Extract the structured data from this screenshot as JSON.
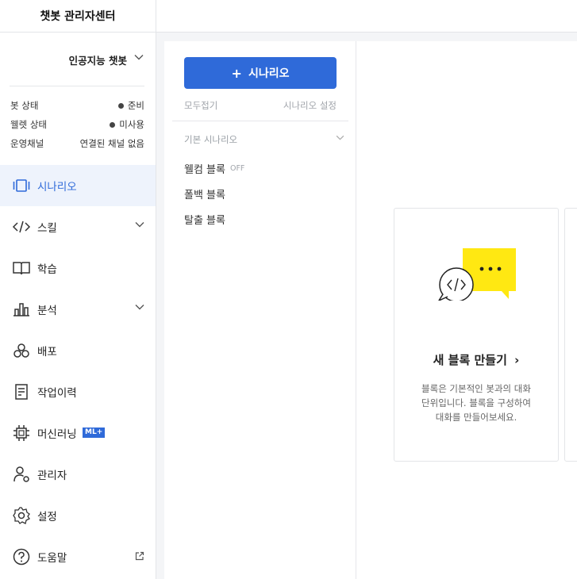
{
  "header": {
    "title": "챗봇 관리자센터"
  },
  "sidebar": {
    "bot_name": "인공지능 챗봇",
    "status": [
      {
        "label": "봇 상태",
        "value": "준비",
        "dot": true
      },
      {
        "label": "웰렛 상태",
        "value": "미사용",
        "dot": true
      },
      {
        "label": "운영채널",
        "value": "연결된 채널 없음",
        "dot": false
      }
    ],
    "nav": [
      {
        "label": "시나리오",
        "icon": "scenario-icon",
        "active": true
      },
      {
        "label": "스킬",
        "icon": "code-icon",
        "chevron": true
      },
      {
        "label": "학습",
        "icon": "book-icon"
      },
      {
        "label": "분석",
        "icon": "bar-chart-icon",
        "chevron": true
      },
      {
        "label": "배포",
        "icon": "deploy-icon"
      },
      {
        "label": "작업이력",
        "icon": "history-icon"
      },
      {
        "label": "머신러닝",
        "icon": "chip-icon",
        "badge": "ML+"
      },
      {
        "label": "관리자",
        "icon": "admin-user-icon"
      },
      {
        "label": "설정",
        "icon": "gear-icon"
      },
      {
        "label": "도움말",
        "icon": "help-icon",
        "external": true
      }
    ]
  },
  "scenario_panel": {
    "add_button": "시나리오",
    "collapse_all": "모두접기",
    "scenario_settings": "시나리오 설정",
    "group_title": "기본 시나리오",
    "blocks": [
      {
        "label": "웰컴 블록",
        "tag": "OFF"
      },
      {
        "label": "폴백 블록"
      },
      {
        "label": "탈출 블록"
      }
    ]
  },
  "main": {
    "card_title": "새 블록 만들기",
    "card_desc_line1": "블록은 기본적인 봇과의 대화",
    "card_desc_line2": "단위입니다. 블록을 구성하여",
    "card_desc_line3": "대화를 만들어보세요."
  },
  "colors": {
    "accent": "#2f6ad9",
    "yellow": "#ffe812"
  }
}
